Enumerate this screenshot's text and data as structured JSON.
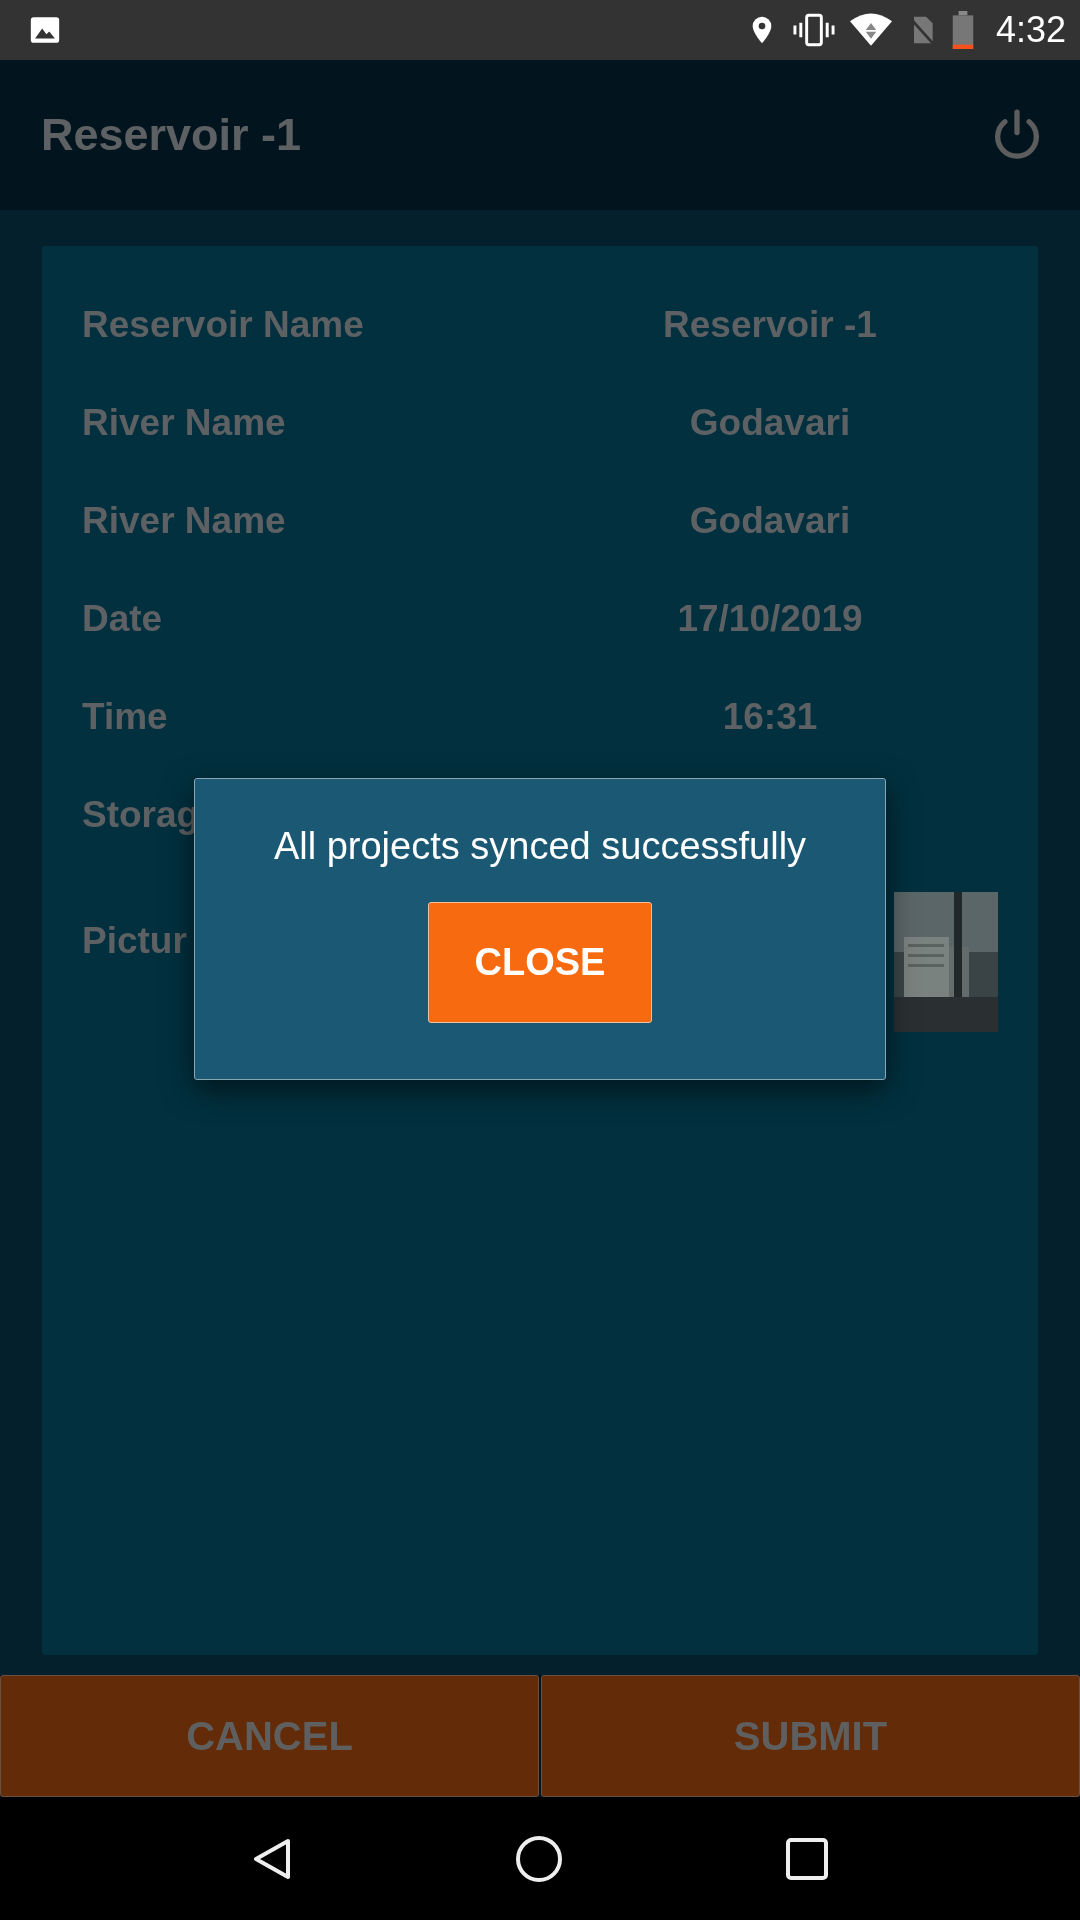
{
  "status_bar": {
    "time": "4:32"
  },
  "app_bar": {
    "title": "Reservoir -1"
  },
  "details": [
    {
      "label": "Reservoir Name",
      "value": "Reservoir -1"
    },
    {
      "label": "River Name",
      "value": "Godavari"
    },
    {
      "label": "River Name",
      "value": "Godavari"
    },
    {
      "label": "Date",
      "value": "17/10/2019"
    },
    {
      "label": "Time",
      "value": "16:31"
    },
    {
      "label": "Storag"
    }
  ],
  "picture_row": {
    "label": "Pictur",
    "kind": "picture"
  },
  "dialog": {
    "message": "All projects synced successfully",
    "button": "CLOSE"
  },
  "buttons": [
    "CANCEL",
    "SUBMIT"
  ]
}
